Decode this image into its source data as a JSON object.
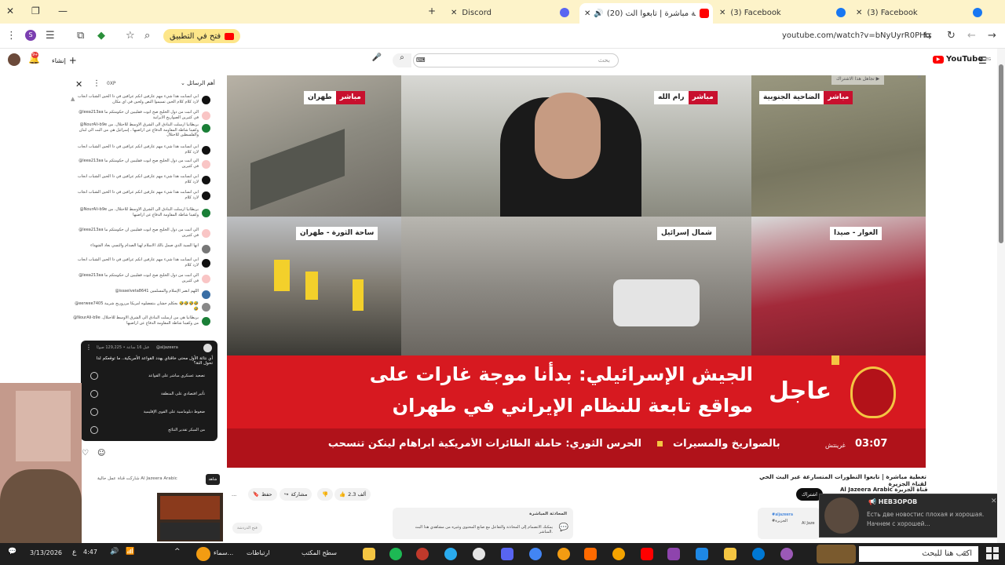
{
  "browser": {
    "tabs": [
      {
        "label": "Discord",
        "icon": "discord-icon",
        "color": "#5865f2"
      },
      {
        "label": "(20) تغطية مباشرة | تابعوا الت",
        "icon": "youtube-icon",
        "color": "#ff0000"
      },
      {
        "label": "(3) Facebook",
        "icon": "facebook-icon",
        "color": "#1877f2"
      },
      {
        "label": "(3) Facebook",
        "icon": "facebook-icon",
        "color": "#1877f2"
      }
    ],
    "new_tab": "+",
    "open_in_app": "فتح في التطبيق",
    "url": "youtube.com/watch?v=bNyUyrR0PHo"
  },
  "yt": {
    "search_placeholder": "بحث",
    "create_label": "إنشاء",
    "logo_text": "YouTube",
    "logo_suffix": "EG"
  },
  "chat": {
    "header": "أهم الرسائل",
    "user_chip": "0XP",
    "messages": [
      {
        "text": "ابي انسابت هذا شيء مهم عارفين انكم عرافين في ذا الحين الشباب انجاب لارد كلام كلام الحين تسيموا النص ولحين في اي مكان",
        "color": "#111"
      },
      {
        "text": "@leea213aa الي انبت من دول الخليج صح ابوت فقليبين ان حكومتكم ما في كثيرين الصواريخ الايرانية",
        "color": "#f9c5c5"
      },
      {
        "text": "@NourAli-b9e بريطانيا ارسلت البنادق الى الشرق الاوسط للاحتلال. من وكفينا شاطة المقاومة الدفاع عن اراضيها ، إسرائيل هي من البت الى لبنان والفلسطين للاحتلال",
        "color": "#1a7f37"
      },
      {
        "text": "ابي انسابت هذا شيء مهم عارفين انكم عرافين في ذا الحين الشباب انجاب لارد كلام",
        "color": "#111"
      },
      {
        "text": "@leea213aa الي انبت من دول الخليج صح ابوت فقليبين ان حكومتكم ما في كثيرين",
        "color": "#f9c5c5"
      },
      {
        "text": "ابي انسابت هذا شيء مهم عارفين انكم عرافين في ذا الحين الشباب انجاب لارد كلام",
        "color": "#111"
      },
      {
        "text": "ابي انسابت هذا شيء مهم عارفين انكم عرافين في ذا الحين الشباب انجاب لارد كلام",
        "color": "#111"
      },
      {
        "text": "@NourAli-b9e بريطانيا ارسلت البنادق الى الشرق الاوسط للاحتلال. من وكفينا شاطة المقاومة الدفاع عن اراضيها",
        "color": "#1a7f37"
      },
      {
        "text": "@leea213aa الي انبت من دول الخليج صح ابوت فقليبين ان حكومتكم ما في كثيرين",
        "color": "#f9c5c5"
      },
      {
        "text": "انها السيد الذي صمل بالك الاسلام لهيا الصدام والتسي بعاد الشهداء",
        "color": "#777"
      },
      {
        "text": "ابي انسابت هذا شيء مهم عارفين انكم عرافين في ذا الحين الشباب انجاب لارد كلام",
        "color": "#111"
      },
      {
        "text": "@leea213aa الي انبت من دول الخليج صح ابوت فقليبين ان حكومتكم ما في كثيرين",
        "color": "#f9c5c5"
      },
      {
        "text": "@issaelveta8641 اللهم انصر الإسلام والمسلمين",
        "color": "#3a6ea5"
      },
      {
        "text": "@eerwee7405 بجكلم حشان بنتفضلوه امريكا مرروريج شريبة 🤣🤣🤣🤣🤣",
        "color": "#888"
      },
      {
        "text": "@NourAli-b9e بريطانيا هي من ارسلت البنادق الى الشرق الاوسط للاحتلال. من وكفينا شاطة المقاومة الدفاع عن اراضيها",
        "color": "#1a7f37"
      }
    ]
  },
  "poll": {
    "channel": "@aljazeera",
    "meta": "قبل 16 ساعة • 129,225 صوتًا",
    "question": "أي نتائة الأول محتى خاقتاي يهدد القواعد الأمريكية.. ما توقعكم لدا تحول التة؟",
    "options": [
      "تصعيد عسكري مباشر على القواعد",
      "تأثير اقتصادي على المنطقة",
      "ضغوط دبلوماسية على القوى الإقليمية",
      "من المبكر تقدير النتائج"
    ]
  },
  "video": {
    "labels": [
      {
        "live": "مباشر",
        "place": "طهران"
      },
      {
        "live": "مباشر",
        "place": "رام الله"
      },
      {
        "live": "مباشر",
        "place": "الضاحية الجنوبية"
      },
      {
        "place": "ساحة الثورة - طهران"
      },
      {
        "place": "شمال إسرائيل"
      },
      {
        "place": "الغوار - صيدا"
      }
    ],
    "breaking_label": "عاجل",
    "breaking_line1": "الجيش الإسرائيلي: بدأنا موجة غارات على",
    "breaking_line2": "مواقع تابعة للنظام الإيراني في طهران",
    "ticker_time": "03:07",
    "ticker_zone": "غرينتش",
    "ticker_text1": "الحرس الثوري: حاملة الطائرات الأمريكية أبراهام لينكن تنسحب",
    "ticker_text2": "بالصواريخ والمسيرات",
    "skip_ad": "تجاهل هذا الاشتراك"
  },
  "below": {
    "title": "تغطية مباشرة | تابعوا التطورات المتسارعة عبر البث الحي لقناة الجزيرة",
    "channel": "Al Jazeera Arabic قناة الجزيرة",
    "subscribe": "اشتراك",
    "likes": "2.3 ألف",
    "share": "مشاركة",
    "save": "حفظ",
    "more": "...",
    "chat_note_title": "المحادثة المباشرة",
    "chat_note": "يمكنك الانضمام إلى المحادثة والتفاعل مع صانع المحتوى وغيره من مشاهدي هذا البث المباشر.",
    "chat_note_button": "فتح الدردشة",
    "desc_hash": "#aljazeera",
    "desc_line": "#الجزيرة",
    "desc_channel": "Al Jaze",
    "channel_strip": "شاركت قناة Al Jazeera Arabic",
    "channel_strip2": "عمل حالية",
    "channel_strip3": "شاهد"
  },
  "notification": {
    "app": "НЕВЗОРОВ",
    "text": "Есть две новостис плохая и хорошая. Начнем с хорошей..."
  },
  "taskbar": {
    "date": "3/13/2026",
    "time": "4:47",
    "lang": "ع",
    "search_placeholder": "اكتب هنا للبحث",
    "desktop": "سطح المكتب",
    "links": "ارتباطات",
    "weather": "سماء..."
  }
}
